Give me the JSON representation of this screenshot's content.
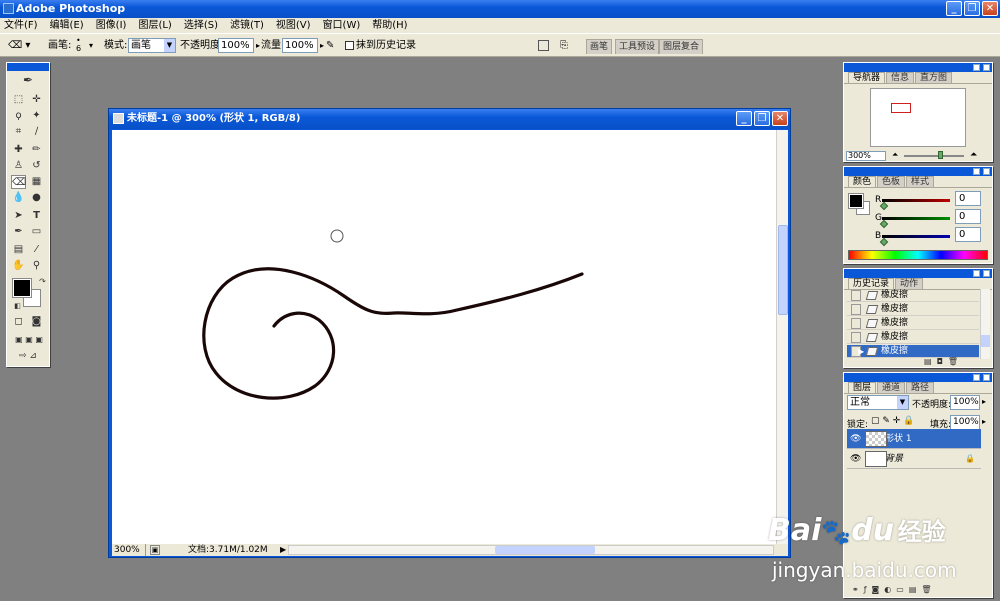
{
  "app": {
    "title": "Adobe Photoshop"
  },
  "window_buttons": {
    "minimize": "_",
    "restore": "❐",
    "close": "✕"
  },
  "menu": [
    "文件(F)",
    "编辑(E)",
    "图像(I)",
    "图层(L)",
    "选择(S)",
    "滤镜(T)",
    "视图(V)",
    "窗口(W)",
    "帮助(H)"
  ],
  "options": {
    "brush_label": "画笔:",
    "brush_size": "6",
    "mode_label": "模式:",
    "mode_value": "画笔",
    "opacity_label": "不透明度:",
    "opacity_value": "100%",
    "flow_label": "流量:",
    "flow_value": "100%",
    "erase_history_label": "抹到历史记录",
    "wells": [
      "画笔",
      "工具预设",
      "图层复合"
    ]
  },
  "document": {
    "title": "未标题-1 @ 300% (形状 1, RGB/8)",
    "zoom": "300%",
    "doc_info": "文档:3.71M/1.02M"
  },
  "navigator": {
    "tabs": [
      "导航器",
      "信息",
      "直方图"
    ],
    "zoom": "300%"
  },
  "color": {
    "tabs": [
      "颜色",
      "色板",
      "样式"
    ],
    "channels": [
      {
        "label": "R",
        "value": "0",
        "color": "#c00000"
      },
      {
        "label": "G",
        "value": "0",
        "color": "#009000"
      },
      {
        "label": "B",
        "value": "0",
        "color": "#0000b0"
      }
    ]
  },
  "history": {
    "tabs": [
      "历史记录",
      "动作"
    ],
    "items": [
      "橡皮擦",
      "橡皮擦",
      "橡皮擦",
      "橡皮擦",
      "橡皮擦"
    ],
    "selected_index": 4
  },
  "layers": {
    "tabs": [
      "图层",
      "通道",
      "路径"
    ],
    "blend_mode": "正常",
    "opacity_label": "不透明度:",
    "opacity_value": "100%",
    "lock_label": "锁定:",
    "fill_label": "填充:",
    "fill_value": "100%",
    "items": [
      {
        "name": "形状 1",
        "selected": true
      },
      {
        "name": "背景",
        "selected": false,
        "locked": true
      }
    ]
  },
  "watermark": {
    "brand": "Bai",
    "brand_tail": "du",
    "product": "经验",
    "url": "jingyan.baidu.com"
  }
}
